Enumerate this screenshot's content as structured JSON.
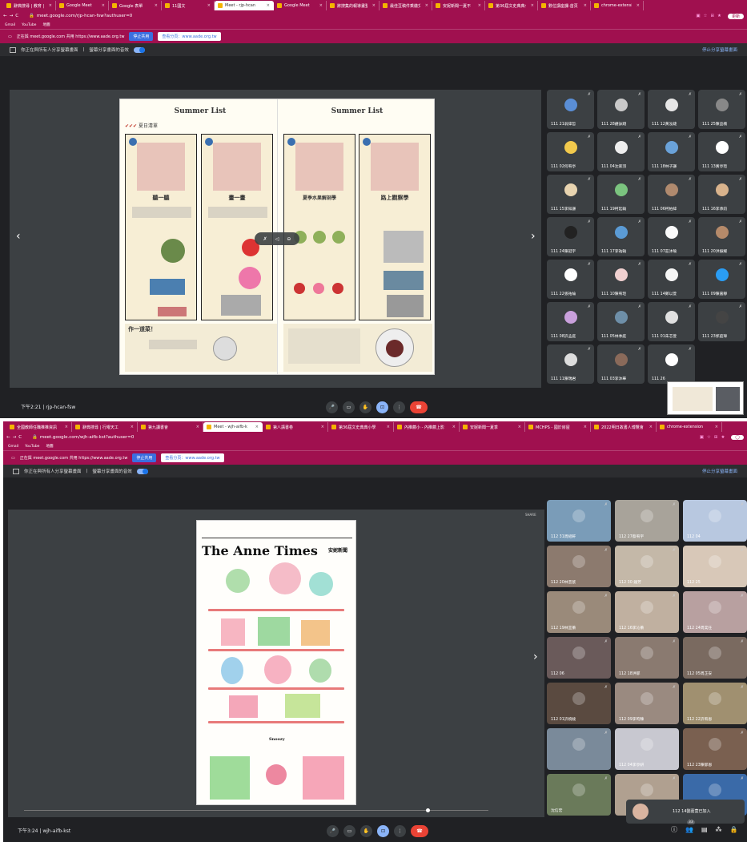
{
  "window1": {
    "tabs": [
      "辭典搜尋 | 教育 | M...",
      "Google Meet",
      "Google 表單",
      "11國文",
      "Meet - rjp-hcan",
      "Google Meet",
      "將搜集的報導畫整出",
      "最佳豆稿件乘繳交",
      "安妮新聞一夏不",
      "第36屆文史典典小",
      "數位講座課-首頁",
      "chrome-extension"
    ],
    "active_tab": 4,
    "url": "meet.google.com/rjp-hcan-fsw?authuser=0",
    "bookmarks": [
      "Gmail",
      "YouTube",
      "地圖"
    ],
    "update_label": "更新",
    "share_text": "正在與 meet.google.com 共用 https://www.aade.org.tw",
    "stop_share": "停止共用",
    "switch_share": "查看分頁：www.aade.org.tw",
    "presenting": "你正在與所有人分享螢幕畫面",
    "audio": "螢幕分享畫面的音效",
    "stop_presenting": "停止分享螢幕畫面",
    "doc_header_left": "Summer List",
    "doc_header_right": "Summer List",
    "doc_sub": "夏日清單",
    "cards": [
      {
        "num": "01",
        "title": "聽一聽"
      },
      {
        "num": "02",
        "title": "畫一畫"
      },
      {
        "num": "03",
        "title": "夏季水果解剖學"
      },
      {
        "num": "04",
        "title": "路上觀察學"
      }
    ],
    "bottom_title": "作一道菜！",
    "participants": [
      "111 21翁偉哲",
      "111 28鍾詠翔",
      "111 12黃泓婕",
      "111 25陳品楠",
      "111 02何宥亭",
      "111 04沈家羽",
      "111 18林子謙",
      "111 13黃亭瑄",
      "111 15李知謙",
      "111 19柯廷翰",
      "111 06柯柏緯",
      "111 16李承鈞",
      "111 24陳冠宇",
      "111 17李祐翰",
      "111 07莊沐瑜",
      "111 20洪振耀",
      "111 22張祐綸",
      "111 10陳宥瑄",
      "111 14鄭以萱",
      "111 09陳嘉靜",
      "111 08許孟庭",
      "111 05林季庭",
      "111 01朱芯萱",
      "111 23郭庭瑋",
      "111 11陳瑞君",
      "111 03李沐華",
      "111 26"
    ],
    "time": "下午2:21",
    "code": "rjp-hcan-fsw"
  },
  "window2": {
    "tabs": [
      "全國教師任職推推資訊",
      "辭典搜尋 | 行曜天工",
      "第九讀書會",
      "Meet - wjh-aifb-k",
      "第八講書卷",
      "第36屆文史典典小學",
      "內推薦小 - 內推薦上影",
      "安妮新聞一夏季",
      "MCHPS - 國於房屋",
      "2022明日故書人博覽會",
      "chrome-extension"
    ],
    "active_tab": 3,
    "url": "meet.google.com/wjh-aifb-kst?authuser=0",
    "bookmarks": [
      "Gmail",
      "YouTube",
      "地圖"
    ],
    "share_text": "正在與 meet.google.com 共用 https://www.aade.org.tw",
    "stop_share": "停止共用",
    "switch_share": "查看分頁：www.aade.org.tw",
    "presenting": "你正在與所有人分享螢幕畫面",
    "audio": "螢幕分享畫面的音效",
    "stop_presenting": "停止分享螢幕畫面",
    "share_label": "SHARE",
    "newspaper_title": "The Anne Times",
    "newspaper_brand": "安妮新聞",
    "newspaper_section": "Snoozy",
    "participants": [
      "112 31周紹軒",
      "112 27蔡宥宇",
      "112 04",
      "112 20林芸歆",
      "112 30 鐘芳",
      "112 25",
      "112 19林宜蓁",
      "112 16李沁蓁",
      "112 24周奕任",
      "112 06",
      "112 18洪郁",
      "112 05周芷安",
      "112 01許婉綾",
      "112 09李昀臻",
      "112 22許宥恩",
      "",
      "112 04李亭妍",
      "112 23陳郁恩",
      "沈信宏",
      "",
      ""
    ],
    "toast": "112 14劉嘉萱已加入",
    "badge_count": "33",
    "time": "下午3:24",
    "code": "wjh-aifb-kst"
  }
}
